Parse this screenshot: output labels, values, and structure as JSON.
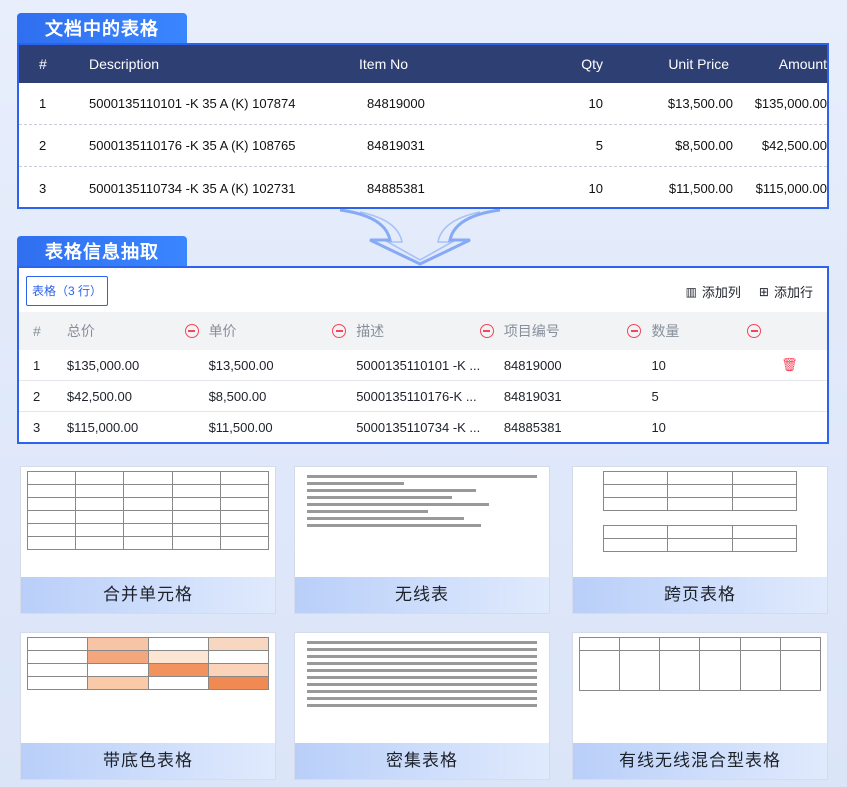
{
  "section1": {
    "title": "文档中的表格"
  },
  "doc_table": {
    "headers": [
      "#",
      "Description",
      "Item No",
      "Qty",
      "Unit Price",
      "Amount"
    ],
    "rows": [
      [
        "1",
        "5000135110101 -K 35 A (K) 107874",
        "84819000",
        "10",
        "$13,500.00",
        "$135,000.00"
      ],
      [
        "2",
        "5000135110176 -K 35 A (K) 108765",
        "84819031",
        "5",
        "$8,500.00",
        "$42,500.00"
      ],
      [
        "3",
        "5000135110734 -K 35 A (K) 102731",
        "84885381",
        "10",
        "$11,500.00",
        "$115,000.00"
      ]
    ]
  },
  "section2": {
    "title": "表格信息抽取"
  },
  "extract": {
    "tag": "表格（3 行）",
    "add_col": "添加列",
    "add_row": "添加行",
    "headers": [
      "#",
      "总价",
      "单价",
      "描述",
      "项目编号",
      "数量"
    ],
    "rows": [
      [
        "1",
        "$135,000.00",
        "$13,500.00",
        "5000135110101 -K ...",
        "84819000",
        "10"
      ],
      [
        "2",
        "$42,500.00",
        "$8,500.00",
        "5000135110176-K ...",
        "84819031",
        "5"
      ],
      [
        "3",
        "$115,000.00",
        "$11,500.00",
        "5000135110734 -K ...",
        "84885381",
        "10"
      ]
    ]
  },
  "cards": [
    {
      "label": "合并单元格"
    },
    {
      "label": "无线表"
    },
    {
      "label": "跨页表格"
    },
    {
      "label": "带底色表格"
    },
    {
      "label": "密集表格"
    },
    {
      "label": "有线无线混合型表格"
    }
  ]
}
